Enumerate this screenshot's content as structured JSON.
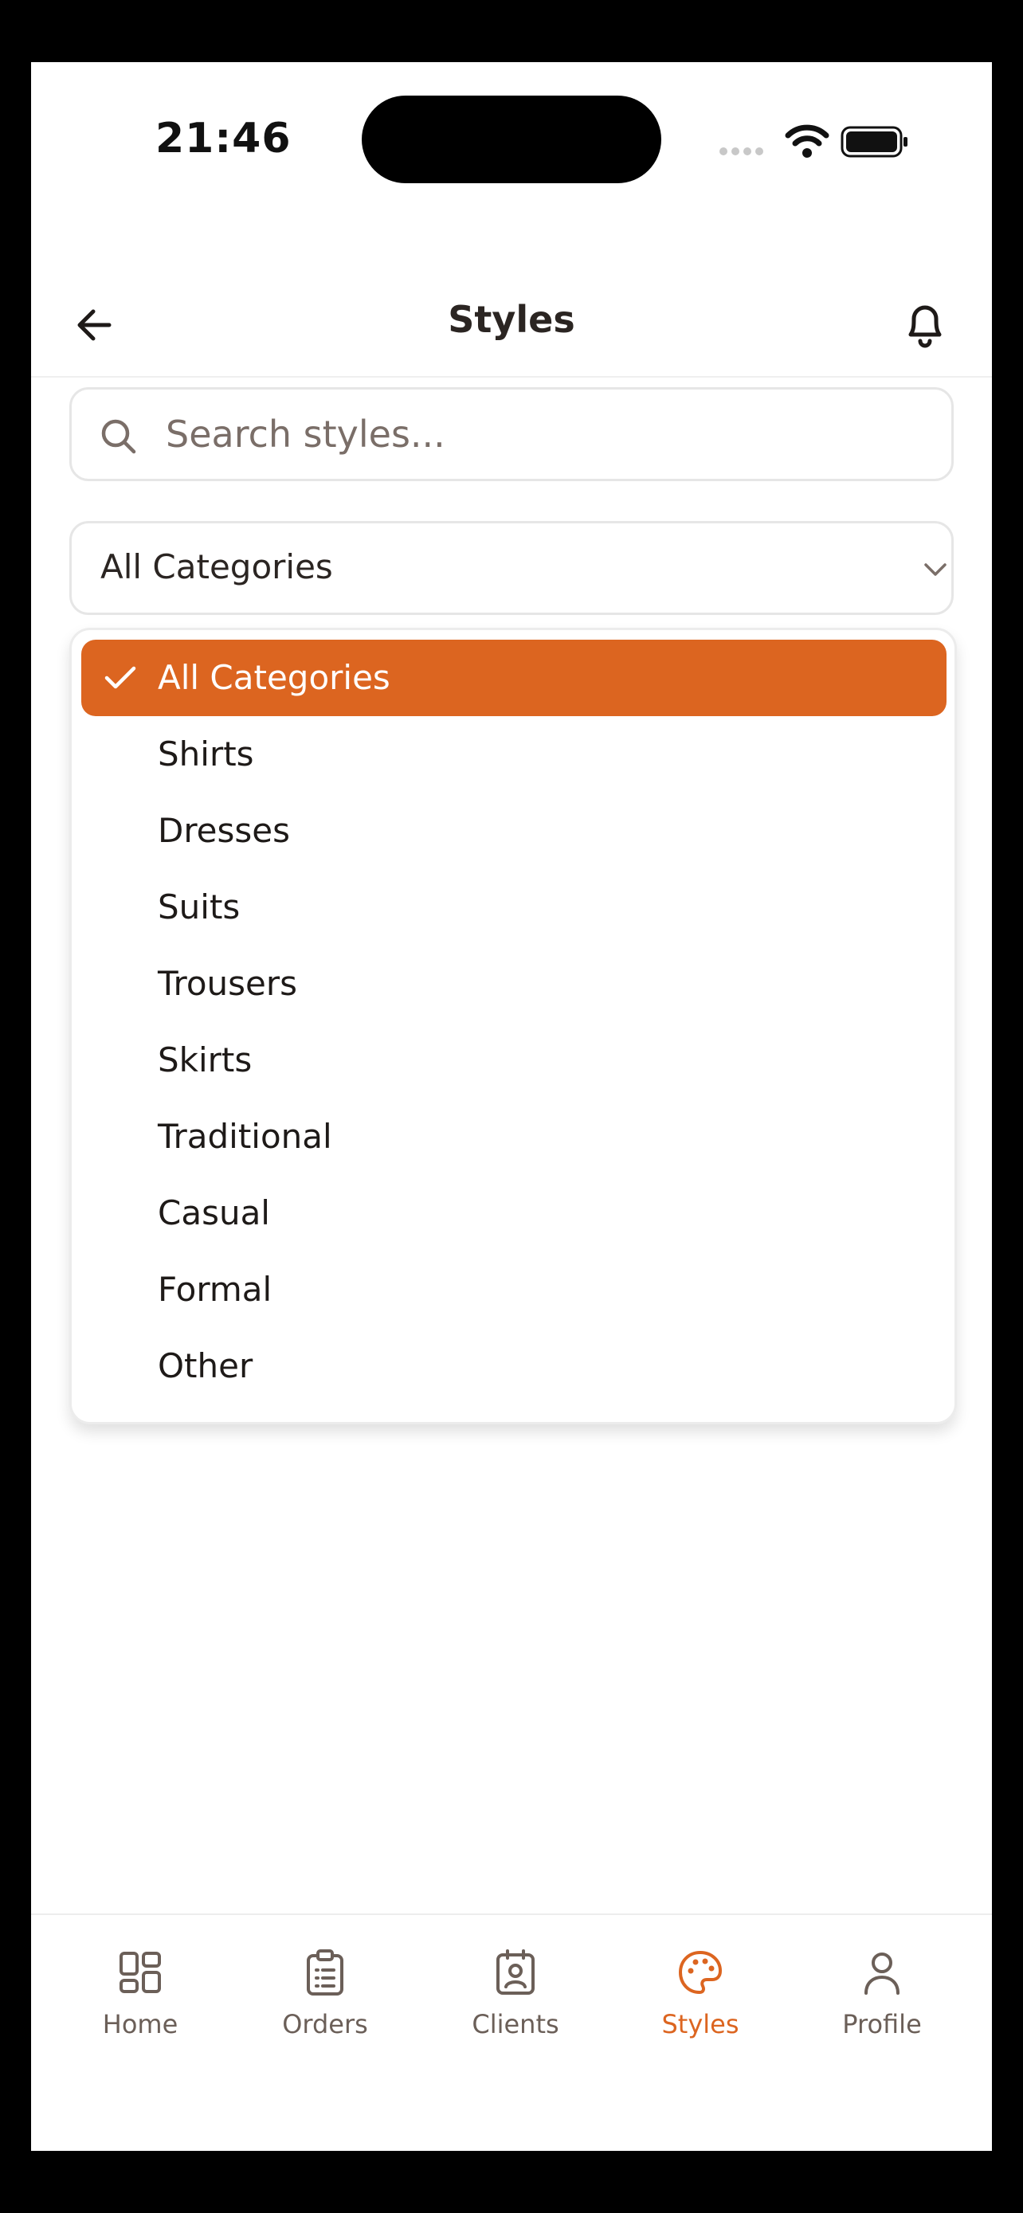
{
  "status_bar": {
    "time": "21:46"
  },
  "header": {
    "title": "Styles"
  },
  "search": {
    "placeholder": "Search styles..."
  },
  "category_select": {
    "selected": "All Categories",
    "options": [
      "All Categories",
      "Shirts",
      "Dresses",
      "Suits",
      "Trousers",
      "Skirts",
      "Traditional",
      "Casual",
      "Formal",
      "Other"
    ]
  },
  "bottom_nav": {
    "items": [
      {
        "label": "Home",
        "icon": "grid-icon"
      },
      {
        "label": "Orders",
        "icon": "clipboard-icon"
      },
      {
        "label": "Clients",
        "icon": "contact-icon"
      },
      {
        "label": "Styles",
        "icon": "palette-icon"
      },
      {
        "label": "Profile",
        "icon": "user-icon"
      }
    ],
    "active": "Styles"
  },
  "colors": {
    "accent": "#dc6520",
    "text_primary": "#2b2522",
    "text_muted": "#6b5f58",
    "border": "#e6e6e6"
  }
}
